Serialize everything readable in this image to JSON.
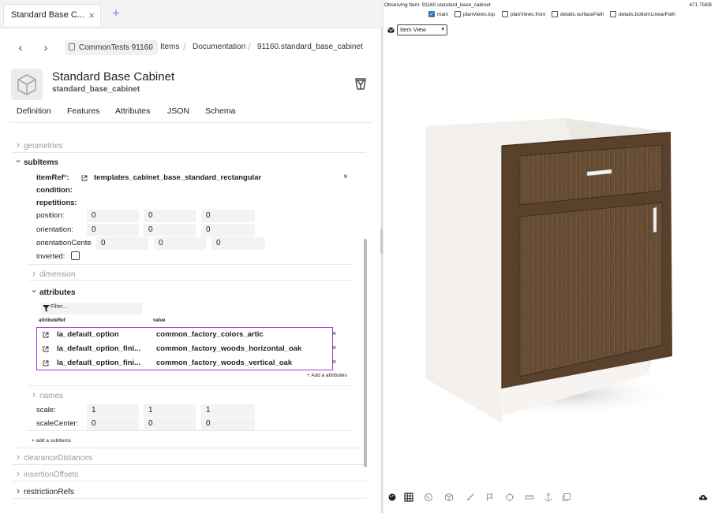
{
  "tab": {
    "title": "Standard Base C...",
    "close": "×",
    "add": "+"
  },
  "nav": {
    "back": "‹",
    "forward": "›",
    "crumbs": [
      "CommonTests 91160",
      "Items",
      "Documentation",
      "91160.standard_base_cabinet"
    ],
    "sep": "/"
  },
  "item": {
    "title": "Standard Base Cabinet",
    "subtitle": "standard_base_cabinet"
  },
  "subtabs": [
    "Definition",
    "Features",
    "Attributes",
    "JSON",
    "Schema"
  ],
  "tree": {
    "geometries": "geometries",
    "subitems": "subItems",
    "itemref_label": "itemRef",
    "itemref_req": "*",
    "itemref_colon": ":",
    "itemref_value": "templates_cabinet_base_standard_rectangular",
    "itemref_close": "×",
    "condition": "condition:",
    "repetitions": "repetitions:",
    "position": {
      "label": "position:",
      "values": [
        "0",
        "0",
        "0"
      ]
    },
    "orientation": {
      "label": "orientation:",
      "values": [
        "0",
        "0",
        "0"
      ]
    },
    "orientation_center": {
      "label": "orientationCente",
      "values": [
        "0",
        "0",
        "0"
      ]
    },
    "inverted": "inverted:",
    "dimension": "dimension",
    "attributes": "attributes",
    "filter_placeholder": "Filter...",
    "col_ref": "attributeRef",
    "col_value": "value",
    "attr_rows": [
      {
        "ref": "la_default_option",
        "value": "common_factory_colors_artic"
      },
      {
        "ref": "la_default_option_fini...",
        "value": "common_factory_woods_horizontal_oak"
      },
      {
        "ref": "la_default_option_fini...",
        "value": "common_factory_woods_vertical_oak"
      }
    ],
    "row_close": "×",
    "add_attribute": "+ Add a attributes",
    "names": "names",
    "scale": {
      "label": "scale:",
      "values": [
        "1",
        "1",
        "1"
      ]
    },
    "scale_center": {
      "label": "scaleCenter:",
      "values": [
        "0",
        "0",
        "0"
      ]
    },
    "add_subitem": "+ add a subItems",
    "clearance": "clearanceDistances",
    "insertion": "insertionOffsets",
    "restriction": "restrictionRefs"
  },
  "viewer": {
    "observing": "Observing Item: 91160.standard_base_cabinet",
    "size": "471.75KB",
    "layers": [
      {
        "label": "main",
        "checked": true
      },
      {
        "label": "planViews.top",
        "checked": false
      },
      {
        "label": "planViews.front",
        "checked": false
      },
      {
        "label": "details.surfacePath",
        "checked": false
      },
      {
        "label": "details.bottomLinearPath",
        "checked": false
      }
    ],
    "view_mode": "Item View",
    "caret": "▾",
    "checkmark": "✓"
  },
  "colors": {
    "accent": "#8a7cc8",
    "selection": "#9a3dd6",
    "wood": "#6b5038",
    "carcass": "#f2efec"
  }
}
